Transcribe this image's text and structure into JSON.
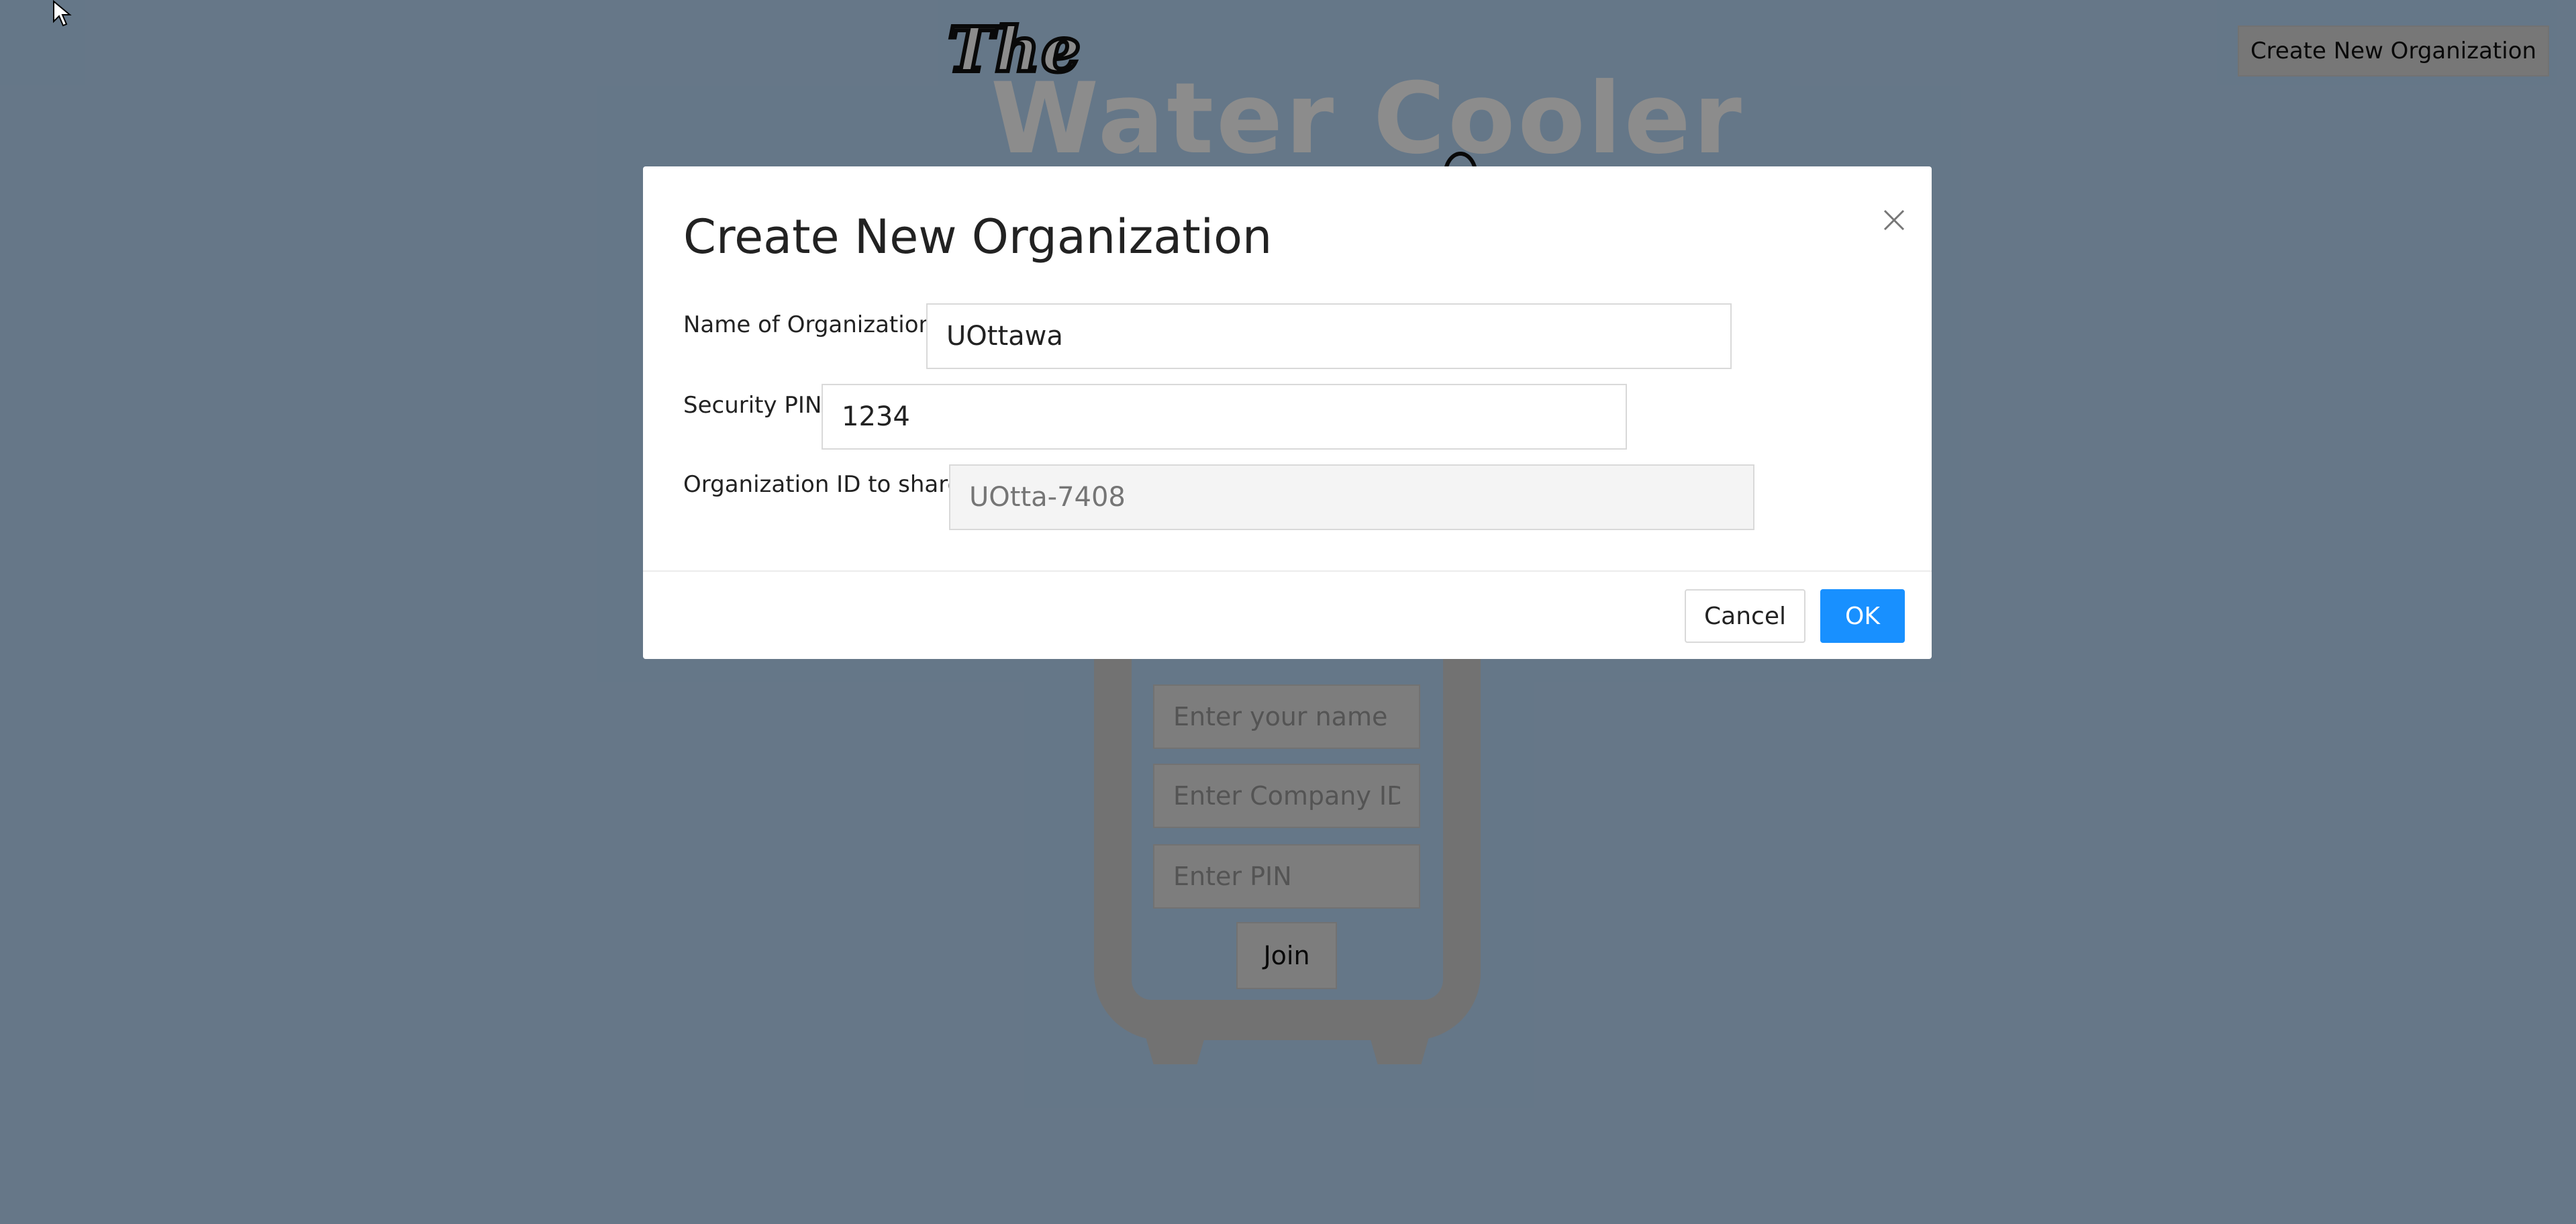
{
  "page": {
    "logo_the": "The",
    "logo_main": "Water Cooler",
    "create_org_button": "Create New Organization",
    "cooler": {
      "name_placeholder": "Enter your name",
      "company_placeholder": "Enter Company ID",
      "pin_placeholder": "Enter PIN",
      "join_label": "Join"
    }
  },
  "modal": {
    "title": "Create New Organization",
    "fields": {
      "org_name": {
        "label": "Name of Organization",
        "value": "UOttawa"
      },
      "pin": {
        "label": "Security PIN",
        "value": "1234"
      },
      "org_id": {
        "label": "Organization ID to share",
        "placeholder": "UOtta-7408"
      }
    },
    "cancel_label": "Cancel",
    "ok_label": "OK"
  },
  "colors": {
    "primary": "#1890ff",
    "background": "#b9d9f7"
  },
  "icons": {
    "close": "close-icon",
    "cursor": "cursor-arrow-icon"
  }
}
